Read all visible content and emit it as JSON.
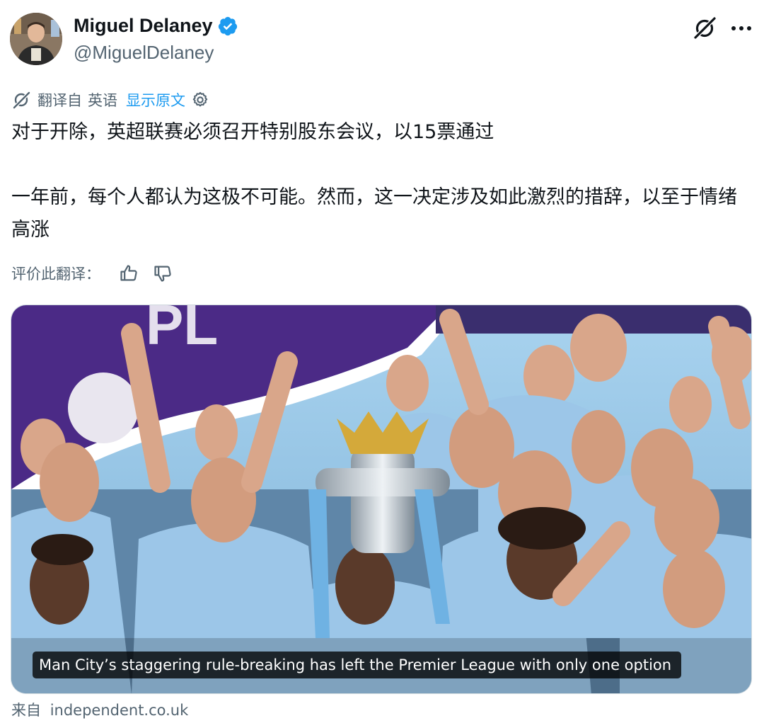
{
  "tweet": {
    "author": {
      "display_name": "Miguel Delaney",
      "handle": "@MiguelDelaney",
      "verified_icon": "verified-badge-icon"
    },
    "translation_bar": {
      "from_label": "翻译自",
      "language": "英语",
      "show_original": "显示原文"
    },
    "paragraphs": [
      "对于开除，英超联赛必须召开特别股东会议，以15票通过",
      "一年前，每个人都认为这极不可能。然而，这一决定涉及如此激烈的措辞，以至于情绪高涨"
    ],
    "rating": {
      "label": "评价此翻译："
    },
    "link_card": {
      "caption": "Man City’s staggering rule-breaking has left the Premier League with only one option",
      "source_prefix": "来自",
      "source_domain": "independent.co.uk"
    }
  },
  "colors": {
    "accent": "#1d9bf0",
    "secondary_text": "#536471",
    "primary_text": "#0f1419",
    "border": "#cfd9de"
  }
}
